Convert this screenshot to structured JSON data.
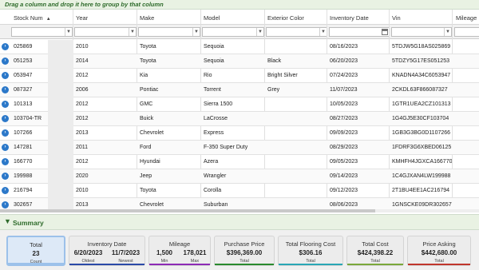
{
  "group_bar": {
    "text": "Drag a column and drop it here to group by that column"
  },
  "columns": [
    {
      "label": "Stock Num"
    },
    {
      "label": "Year"
    },
    {
      "label": "Make"
    },
    {
      "label": "Model"
    },
    {
      "label": "Exterior Color"
    },
    {
      "label": "Inventory Date"
    },
    {
      "label": "Vin"
    },
    {
      "label": "Mileage"
    }
  ],
  "filter_icons": {
    "dropdown": "chevron-down-icon",
    "calendar": "calendar-icon"
  },
  "rows": [
    {
      "stock": "025869",
      "year": "2010",
      "make": "Toyota",
      "model": "Sequoia",
      "color": "",
      "date": "08/16/2023",
      "vin": "5TDJW5G18AS025869"
    },
    {
      "stock": "051253",
      "year": "2014",
      "make": "Toyota",
      "model": "Sequoia",
      "color": "Black",
      "date": "06/20/2023",
      "vin": "5TDZY5G17ES051253"
    },
    {
      "stock": "053947",
      "year": "2012",
      "make": "Kia",
      "model": "Rio",
      "color": "Bright Silver",
      "date": "07/24/2023",
      "vin": "KNADN4A34C6053947"
    },
    {
      "stock": "087327",
      "year": "2006",
      "make": "Pontiac",
      "model": "Torrent",
      "color": "Grey",
      "date": "11/07/2023",
      "vin": "2CKDL63F866087327"
    },
    {
      "stock": "101313",
      "year": "2012",
      "make": "GMC",
      "model": "Sierra 1500",
      "color": "",
      "date": "10/05/2023",
      "vin": "1GTR1UEA2CZ101313"
    },
    {
      "stock": "103704-TR",
      "year": "2012",
      "make": "Buick",
      "model": "LaCrosse",
      "color": "",
      "date": "08/27/2023",
      "vin": "1G4GJ5E30CF103704"
    },
    {
      "stock": "107266",
      "year": "2013",
      "make": "Chevrolet",
      "model": "Express",
      "color": "",
      "date": "09/09/2023",
      "vin": "1GB3G3BG0D1107266"
    },
    {
      "stock": "147281",
      "year": "2011",
      "make": "Ford",
      "model": "F-350 Super Duty",
      "color": "",
      "date": "08/29/2023",
      "vin": "1FDRF3G6XBED06125"
    },
    {
      "stock": "166770",
      "year": "2012",
      "make": "Hyundai",
      "model": "Azera",
      "color": "",
      "date": "09/05/2023",
      "vin": "KMHFH4JGXCA166770"
    },
    {
      "stock": "199988",
      "year": "2020",
      "make": "Jeep",
      "model": "Wrangler",
      "color": "",
      "date": "09/14/2023",
      "vin": "1C4GJXAN4LW199988"
    },
    {
      "stock": "216794",
      "year": "2010",
      "make": "Toyota",
      "model": "Corolla",
      "color": "",
      "date": "09/12/2023",
      "vin": "2T1BU4EE1AC216794"
    },
    {
      "stock": "302657",
      "year": "2013",
      "make": "Chevrolet",
      "model": "Suburban",
      "color": "",
      "date": "08/06/2023",
      "vin": "1GNSCKE09DR302657"
    }
  ],
  "summary": {
    "title": "Summary",
    "cards": [
      {
        "title": "Total",
        "value": "23",
        "sub": "Count"
      },
      {
        "title": "Inventory Date",
        "value_left": "6/20/2023",
        "value_right": "11/7/2023",
        "sub_left": "Oldest",
        "sub_right": "Newest"
      },
      {
        "title": "Mileage",
        "value_left": "1,500",
        "value_right": "178,021",
        "sub_left": "Min",
        "sub_right": "Max"
      },
      {
        "title": "Purchase Price",
        "value": "$396,369.00",
        "sub": "Total"
      },
      {
        "title": "Total Flooring Cost",
        "value": "$306.16",
        "sub": "Total"
      },
      {
        "title": "Total Cost",
        "value": "$424,398.22",
        "sub": "Total"
      },
      {
        "title": "Price Asking",
        "value": "$442,680.00",
        "sub": "Total"
      }
    ],
    "stripe_colors": [
      "#9cc1ea",
      "#2b4aa8",
      "#8d2bb5",
      "#2a8a2e",
      "#2aa7b5",
      "#7aa83a",
      "#c0362c"
    ]
  },
  "colors": {
    "accent_green": "#2e6b2b",
    "expand_blue": "#2b78c9"
  }
}
